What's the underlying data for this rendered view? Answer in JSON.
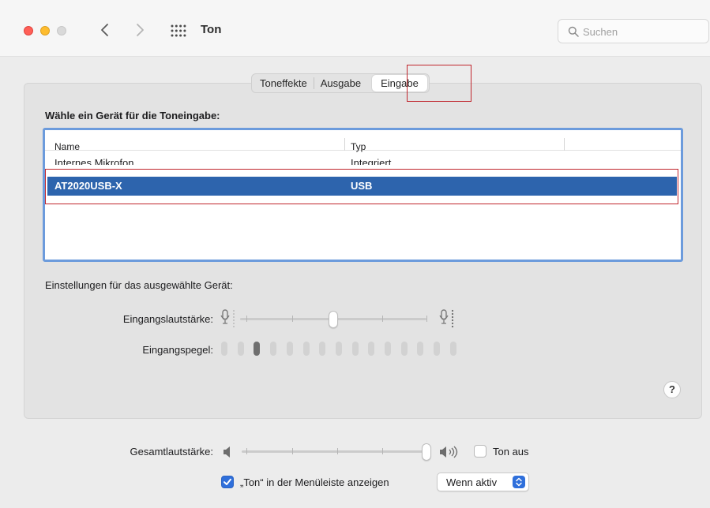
{
  "window": {
    "title": "Ton",
    "search_placeholder": "Suchen"
  },
  "tabs": [
    {
      "label": "Toneffekte",
      "selected": false
    },
    {
      "label": "Ausgabe",
      "selected": false
    },
    {
      "label": "Eingabe",
      "selected": true
    }
  ],
  "input": {
    "section_title": "Wähle ein Gerät für die Toneingabe:",
    "columns": [
      "Name",
      "Typ"
    ],
    "devices": [
      {
        "name": "Internes Mikrofon",
        "type": "Integriert",
        "selected": false
      },
      {
        "name": "AT2020USB-X",
        "type": "USB",
        "selected": true
      }
    ],
    "settings_label": "Einstellungen für das ausgewählte Gerät:",
    "volume_label": "Eingangslautstärke:",
    "volume_level": 0.5,
    "level_label": "Eingangspegel:",
    "level_segments_total": 15,
    "level_segments_active": 1,
    "help_label": "?"
  },
  "footer": {
    "master_volume_label": "Gesamtlautstärke:",
    "master_volume_level": 1.0,
    "mute_label": "Ton aus",
    "mute_checked": false,
    "menubar_label": "„Ton“ in der Menüleiste anzeigen",
    "menubar_checked": true,
    "menubar_option": "Wenn aktiv"
  },
  "colors": {
    "accent": "#2f6fdb",
    "selection": "#2d64ad",
    "highlight_box": "#c0262d"
  }
}
